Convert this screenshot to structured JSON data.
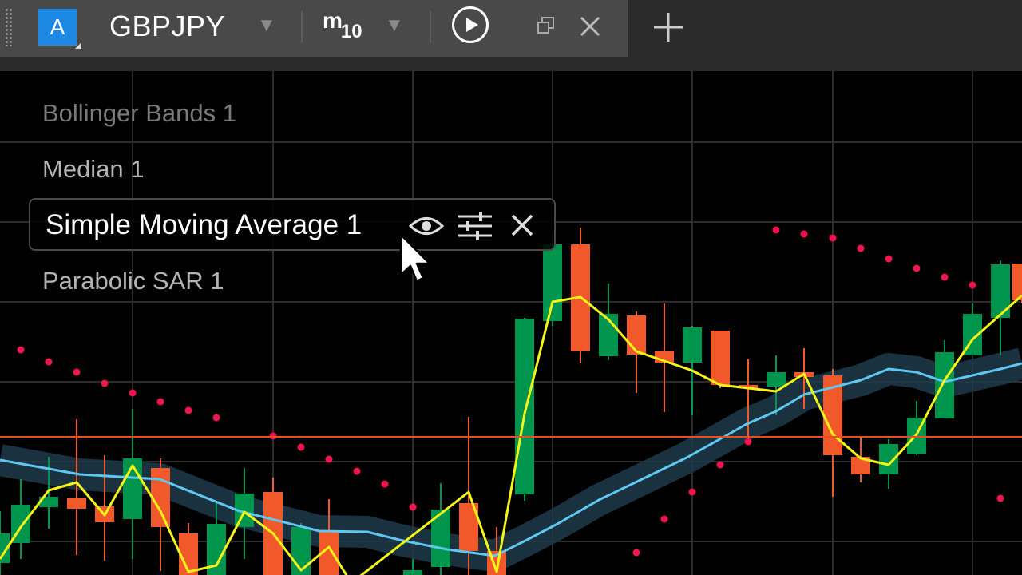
{
  "toolbar": {
    "account_letter": "A",
    "symbol": "GBPJPY",
    "timeframe_letter": "m",
    "timeframe_number": "10",
    "add_tab_glyph": "+"
  },
  "indicators": {
    "bollinger": "Bollinger Bands 1",
    "median": "Median 1",
    "sma": "Simple Moving Average 1",
    "psar": "Parabolic SAR 1"
  },
  "colors": {
    "bull": "#00954d",
    "bear": "#f2592a",
    "sma_line": "#f5f516",
    "median_line": "#5fc8f2",
    "band": "#1e3a4a",
    "psar_dots": "#f0154f",
    "price_line": "#f04a23",
    "account_badge": "#1e88e5"
  },
  "icons": [
    "drag-handle-icon",
    "dropdown-caret-icon",
    "play-icon",
    "restore-window-icon",
    "close-icon",
    "plus-icon",
    "eye-icon",
    "settings-sliders-icon",
    "remove-icon",
    "mouse-pointer-icon"
  ]
}
